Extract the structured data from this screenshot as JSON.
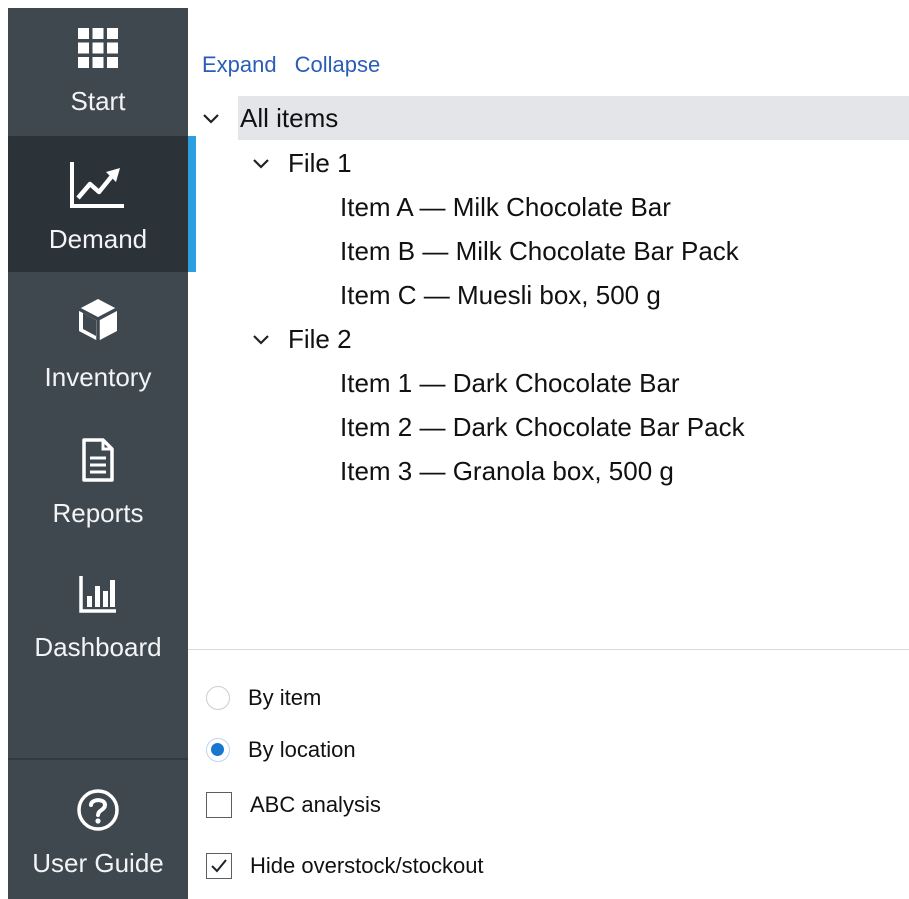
{
  "sidebar": {
    "items": [
      {
        "label": "Start",
        "icon": "grid-icon",
        "active": false
      },
      {
        "label": "Demand",
        "icon": "chart-line-icon",
        "active": true
      },
      {
        "label": "Inventory",
        "icon": "box-icon",
        "active": false
      },
      {
        "label": "Reports",
        "icon": "document-icon",
        "active": false
      },
      {
        "label": "Dashboard",
        "icon": "bar-chart-icon",
        "active": false
      }
    ],
    "footer": {
      "label": "User Guide",
      "icon": "help-icon"
    }
  },
  "tree": {
    "expand_label": "Expand",
    "collapse_label": "Collapse",
    "root": {
      "label": "All items",
      "children": [
        {
          "label": "File 1",
          "items": [
            "Item A — Milk Chocolate Bar",
            "Item B — Milk Chocolate Bar Pack",
            "Item C — Muesli box, 500 g"
          ]
        },
        {
          "label": "File 2",
          "items": [
            "Item 1 — Dark Chocolate Bar",
            "Item 2 — Dark Chocolate Bar Pack",
            "Item 3 — Granola box, 500 g"
          ]
        }
      ]
    }
  },
  "options": {
    "by_item": {
      "label": "By item",
      "checked": false
    },
    "by_location": {
      "label": "By location",
      "checked": true
    },
    "abc_analysis": {
      "label": "ABC analysis",
      "checked": false
    },
    "hide_overstock": {
      "label": "Hide overstock/stockout",
      "checked": true
    }
  },
  "colors": {
    "sidebar_bg": "#3f474f",
    "sidebar_active_bg": "#2b3238",
    "accent": "#2d9fe0",
    "link": "#2a5db8",
    "radio_selected": "#1777cf"
  }
}
